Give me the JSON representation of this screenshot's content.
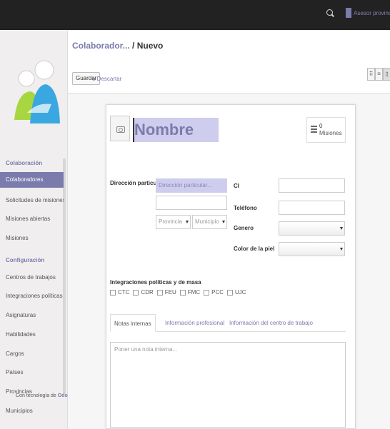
{
  "topbar": {
    "user_label": "Asesor provincial ▾",
    "search_icon": "search-icon",
    "accent": "#7c7bad"
  },
  "sidebar": {
    "section_colaboracion": "Colaboración",
    "items_colaboracion": [
      {
        "label": "Colaboradores",
        "active": true
      },
      {
        "label": "Solicitudes de misiones"
      },
      {
        "label": "Misiones abiertas"
      },
      {
        "label": "Misiones"
      }
    ],
    "section_configuracion": "Configuración",
    "items_configuracion": [
      {
        "label": "Centros de trabajos"
      },
      {
        "label": "Integraciones políticas y..."
      },
      {
        "label": "Asignaturas"
      },
      {
        "label": "Habilidades"
      },
      {
        "label": "Cargos"
      },
      {
        "label": "Países"
      },
      {
        "label": "Provincias"
      },
      {
        "label": "Municipios"
      }
    ],
    "powered_prefix": "Con tecnología de",
    "powered_brand": "Odoo"
  },
  "header": {
    "breadcrumb_parent": "Colaborador...",
    "breadcrumb_sep": " / ",
    "breadcrumb_current": "Nuevo",
    "save_label": "Guardar",
    "discard_label": "o Descartar"
  },
  "form": {
    "name_placeholder": "Nombre",
    "stat_count": "0",
    "stat_label": "Misiones",
    "address_label": "Dirección particular",
    "address_placeholder": "Dirección particular...",
    "province_placeholder": "Provincia",
    "municipality_placeholder": "Municipio",
    "ci_label": "CI",
    "phone_label": "Teléfono",
    "gender_label": "Genero",
    "skin_label": "Color de la piel",
    "integrations_title": "Integraciones políticas y de masa",
    "integrations": [
      "CTC",
      "CDR",
      "FEU",
      "FMC",
      "PCC",
      "UJC"
    ],
    "tabs": [
      {
        "label": "Notas internas",
        "active": true
      },
      {
        "label": "Información profesional"
      },
      {
        "label": "Información del centro de trabajo"
      }
    ],
    "notes_placeholder": "Poner una nota interna..."
  }
}
